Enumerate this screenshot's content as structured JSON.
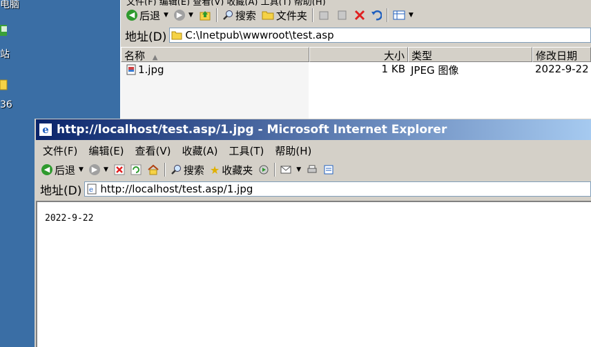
{
  "desktop": {
    "label_top": "电脑",
    "label_mid": "站",
    "label_bottom": "36"
  },
  "explorer": {
    "menu_partial": "文件(F)  编辑(E)  查看(V)  收藏(A)  工具(T)  帮助(H)",
    "toolbar": {
      "back": "后退",
      "search": "搜索",
      "folders": "文件夹"
    },
    "address": {
      "label": "地址(D)",
      "value": "C:\\Inetpub\\wwwroot\\test.asp"
    },
    "columns": [
      "名称",
      "大小",
      "类型",
      "修改日期"
    ],
    "files": [
      {
        "name": "1.jpg",
        "size": "1 KB",
        "type": "JPEG 图像",
        "modified": "2022-9-22"
      }
    ]
  },
  "ie": {
    "title": "http://localhost/test.asp/1.jpg - Microsoft Internet Explorer",
    "menu": [
      "文件(F)",
      "编辑(E)",
      "查看(V)",
      "收藏(A)",
      "工具(T)",
      "帮助(H)"
    ],
    "toolbar": {
      "back": "后退",
      "search": "搜索",
      "favorites": "收藏夹"
    },
    "address": {
      "label": "地址(D)",
      "value": "http://localhost/test.asp/1.jpg"
    },
    "page_content": "2022-9-22"
  }
}
